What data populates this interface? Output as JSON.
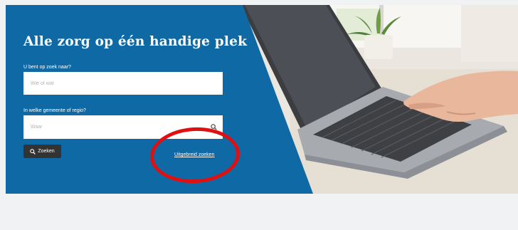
{
  "hero": {
    "title": "Alle zorg op één handige plek",
    "what_label": "U bent op zoek naar?",
    "what_placeholder": "Wie of wat",
    "where_label": "In welke gemeente of regio?",
    "where_placeholder": "Waar",
    "search_button_label": "Zoeken",
    "advanced_search_link": "Uitgebreid zoeken"
  },
  "colors": {
    "panel_blue": "#0f69a5",
    "page_background": "#f1f2f3",
    "button_dark": "#333333",
    "annotation_red": "#e01010"
  },
  "icons": {
    "field_search": "search-icon",
    "button_search": "search-icon"
  }
}
